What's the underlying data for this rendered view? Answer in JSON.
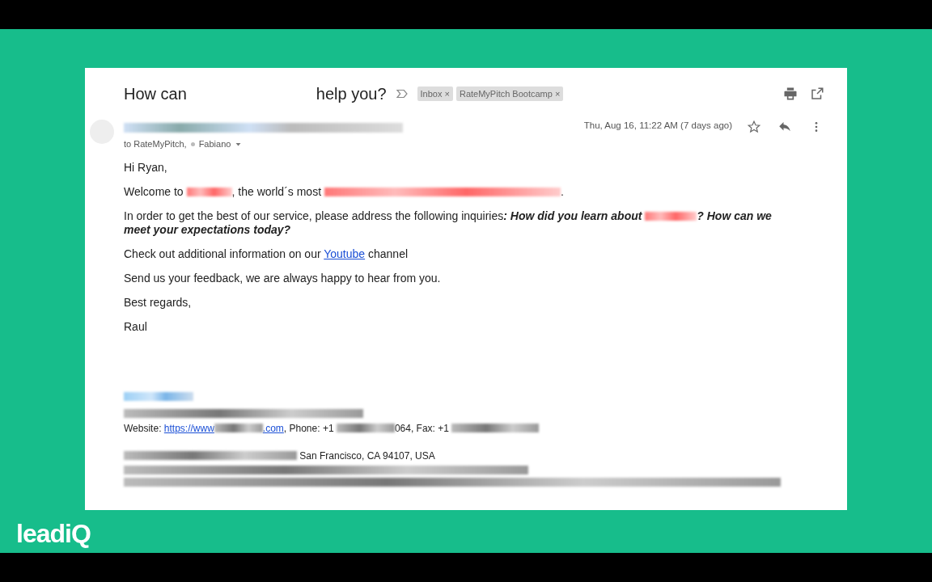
{
  "subject": {
    "parts": [
      {
        "kind": "text",
        "text": "How can"
      },
      {
        "kind": "gap"
      },
      {
        "kind": "text",
        "text": "help you?"
      }
    ],
    "labels": [
      {
        "text": "Inbox",
        "close": "×"
      },
      {
        "text": "RateMyPitch Bootcamp",
        "close": "×"
      }
    ]
  },
  "message": {
    "recipients": [
      {
        "kind": "text",
        "text": "to RateMyPitch,"
      },
      {
        "kind": "dot"
      },
      {
        "kind": "text",
        "text": "Fabiano"
      }
    ],
    "date": "Thu, Aug 16, 11:22 AM (7 days ago)",
    "starred": false,
    "body": [
      [
        {
          "kind": "text",
          "text": "Hi Ryan,"
        }
      ],
      [
        {
          "kind": "text",
          "text": "Welcome to "
        },
        {
          "kind": "redacted"
        },
        {
          "kind": "text",
          "text": ", the world´s most "
        },
        {
          "kind": "redacted"
        },
        {
          "kind": "text",
          "text": "."
        }
      ],
      [
        {
          "kind": "text",
          "text": "In order to get the best of our service, please address the following inquiries"
        },
        {
          "kind": "strong",
          "text": ": How did you learn about "
        },
        {
          "kind": "redacted"
        },
        {
          "kind": "strong",
          "text": "? How can we meet your expectations today?"
        }
      ],
      [
        {
          "kind": "text",
          "text": "Check out additional information on our "
        },
        {
          "kind": "link",
          "text": "Youtube"
        },
        {
          "kind": "text",
          "text": " channel"
        }
      ],
      [
        {
          "kind": "text",
          "text": "Send us your feedback, we are always happy to hear from you."
        }
      ],
      [
        {
          "kind": "text",
          "text": "Best regards,"
        }
      ],
      [
        {
          "kind": "text",
          "text": "Raul"
        }
      ]
    ],
    "signature": [
      [
        {
          "kind": "redacted"
        }
      ],
      [
        {
          "kind": "redacted"
        }
      ],
      [
        {
          "kind": "text",
          "text": "Website: "
        },
        {
          "kind": "link",
          "text": "https://www"
        },
        {
          "kind": "redacted"
        },
        {
          "kind": "link",
          "text": ".com"
        },
        {
          "kind": "text",
          "text": ", Phone: +1 "
        },
        {
          "kind": "redacted"
        },
        {
          "kind": "text",
          "text": "064, Fax: +1 "
        },
        {
          "kind": "redacted"
        }
      ],
      [
        {
          "kind": "redacted"
        },
        {
          "kind": "text",
          "text": " San Francisco, CA 94107, USA"
        }
      ],
      [
        {
          "kind": "redacted"
        }
      ],
      [
        {
          "kind": "redacted"
        }
      ]
    ]
  },
  "brand": {
    "text": "leadiQ"
  }
}
